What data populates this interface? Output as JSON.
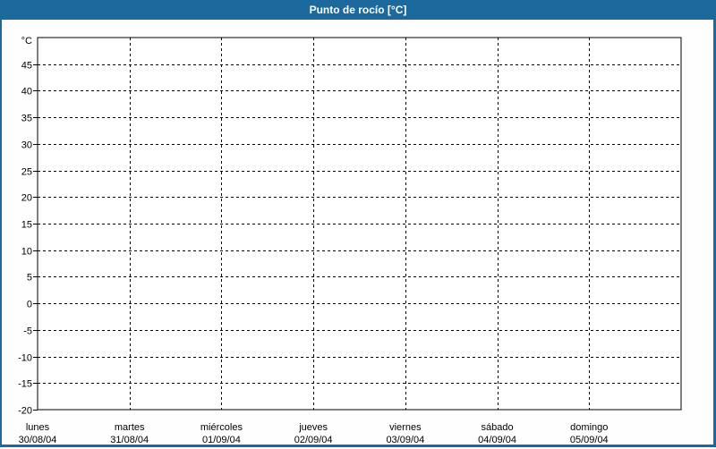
{
  "title_bar": {
    "title": "Punto de rocío [°C]"
  },
  "colors": {
    "accent_blue": "#1c699e",
    "title_text": "#ffffff",
    "page_bg": "#fdfefd",
    "plot_bg": "#ffffff",
    "axis_and_grid": "#000000"
  },
  "chart_data": {
    "type": "line",
    "title": "Punto de rocío [°C]",
    "ylabel": "°C",
    "ylim": [
      -20,
      50
    ],
    "ytick_step": 5,
    "ytick_labels_shown": [
      45,
      40,
      35,
      30,
      25,
      20,
      15,
      10,
      5,
      0,
      -5,
      -10,
      -15,
      -20
    ],
    "grid": true,
    "grid_style": "dashed",
    "categories": [
      {
        "day": "lunes",
        "date": "30/08/04"
      },
      {
        "day": "martes",
        "date": "31/08/04"
      },
      {
        "day": "miércoles",
        "date": "01/09/04"
      },
      {
        "day": "jueves",
        "date": "02/09/04"
      },
      {
        "day": "viernes",
        "date": "03/09/04"
      },
      {
        "day": "sábado",
        "date": "04/09/04"
      },
      {
        "day": "domingo",
        "date": "05/09/04"
      }
    ],
    "series": []
  }
}
